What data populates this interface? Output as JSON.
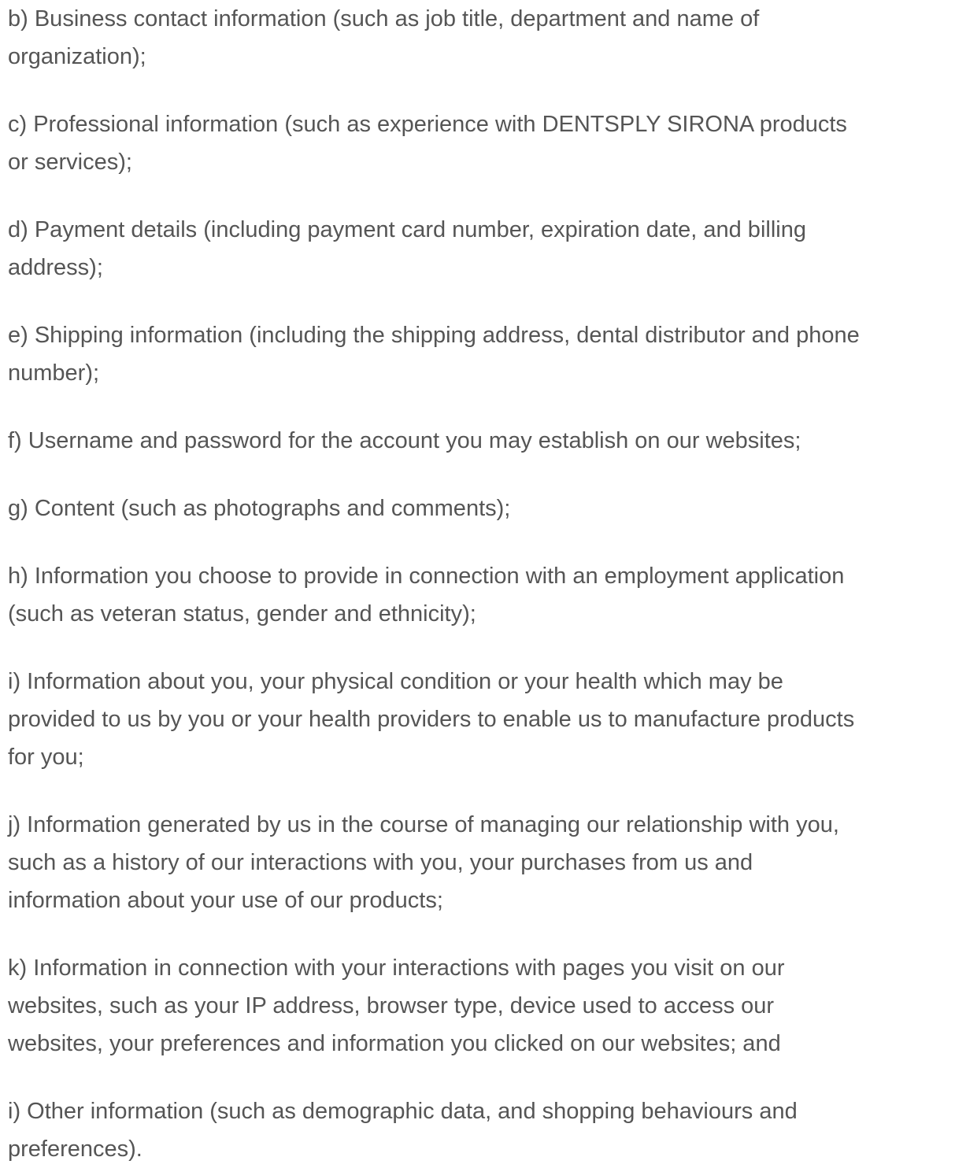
{
  "items": [
    {
      "lines": [
        "b) Business contact information (such as job title, department and name of",
        "organization);"
      ]
    },
    {
      "lines": [
        "c) Professional information (such as experience with DENTSPLY SIRONA products",
        "or services);"
      ]
    },
    {
      "lines": [
        "d) Payment details (including payment card number, expiration date, and billing",
        "address);"
      ]
    },
    {
      "lines": [
        "e) Shipping information (including the shipping address, dental distributor and phone",
        "number);"
      ]
    },
    {
      "lines": [
        "f) Username and password for the account you may establish on our websites;"
      ]
    },
    {
      "lines": [
        "g) Content (such as photographs and comments);"
      ]
    },
    {
      "lines": [
        "h) Information you choose to provide in connection with an employment application",
        "(such as veteran status, gender and ethnicity);"
      ]
    },
    {
      "lines": [
        "i) Information about you, your physical condition or your health which may be",
        "provided to us by you or your health providers to enable us to manufacture products",
        "for you;"
      ]
    },
    {
      "lines": [
        "j) Information generated by us in the course of managing our relationship with you,",
        "such as a history of our interactions with you, your purchases from us and",
        "information about your use of our products;"
      ]
    },
    {
      "lines": [
        "k) Information in connection with your interactions with pages you visit on our",
        "websites, such as your IP address, browser type, device used to access our",
        "websites, your preferences and information you clicked on our websites; and"
      ]
    },
    {
      "lines": [
        "i) Other information (such as demographic data, and shopping behaviours and",
        "preferences)."
      ]
    }
  ]
}
